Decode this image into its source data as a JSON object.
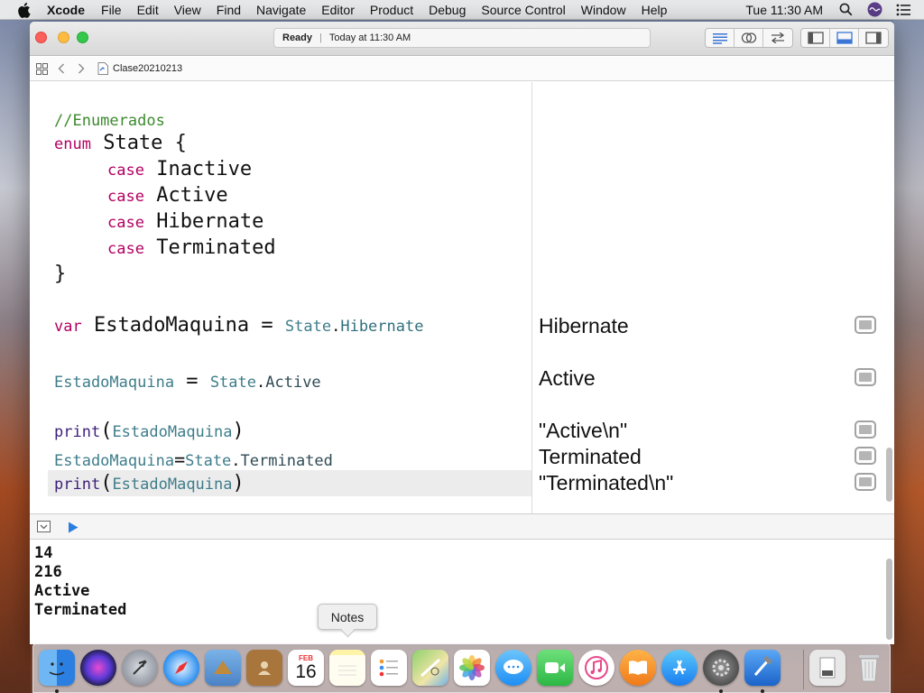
{
  "menubar": {
    "app_name": "Xcode",
    "items": [
      "File",
      "Edit",
      "View",
      "Find",
      "Navigate",
      "Editor",
      "Product",
      "Debug",
      "Source Control",
      "Window",
      "Help"
    ],
    "clock": "Tue 11:30 AM"
  },
  "window": {
    "activity": {
      "status": "Ready",
      "separator": "|",
      "time": "Today at 11:30 AM"
    },
    "breadcrumb": {
      "file": "Clase20210213"
    }
  },
  "editor": {
    "lines": {
      "comment": "//Enumerados",
      "enum_kw": "enum",
      "enum_name": " State {",
      "case_kw": "case",
      "case1": " Inactive",
      "case2": " Active",
      "case3": " Hibernate",
      "case4": " Terminated",
      "close_brace": "}",
      "var_kw": "var",
      "var_name": " EstadoMaquina ",
      "eq": "= ",
      "state_type": "State",
      "dot": ".",
      "hibernate": "Hibernate",
      "estado": "EstadoMaquina",
      "eq_spaced": " = ",
      "active": "Active",
      "print_fn": "print",
      "paren_open": "(",
      "paren_close": ")",
      "eq_tight": "=",
      "terminated": "Terminated"
    }
  },
  "results": {
    "r1": "Hibernate",
    "r2": "Active",
    "r3": "\"Active\\n\"",
    "r4": "Terminated",
    "r5": "\"Terminated\\n\""
  },
  "console": {
    "lines": [
      "14",
      "216",
      "Active",
      "Terminated"
    ]
  },
  "tooltip": {
    "text": "Notes"
  },
  "dock": {
    "calendar": {
      "month": "FEB",
      "day": "16"
    }
  }
}
